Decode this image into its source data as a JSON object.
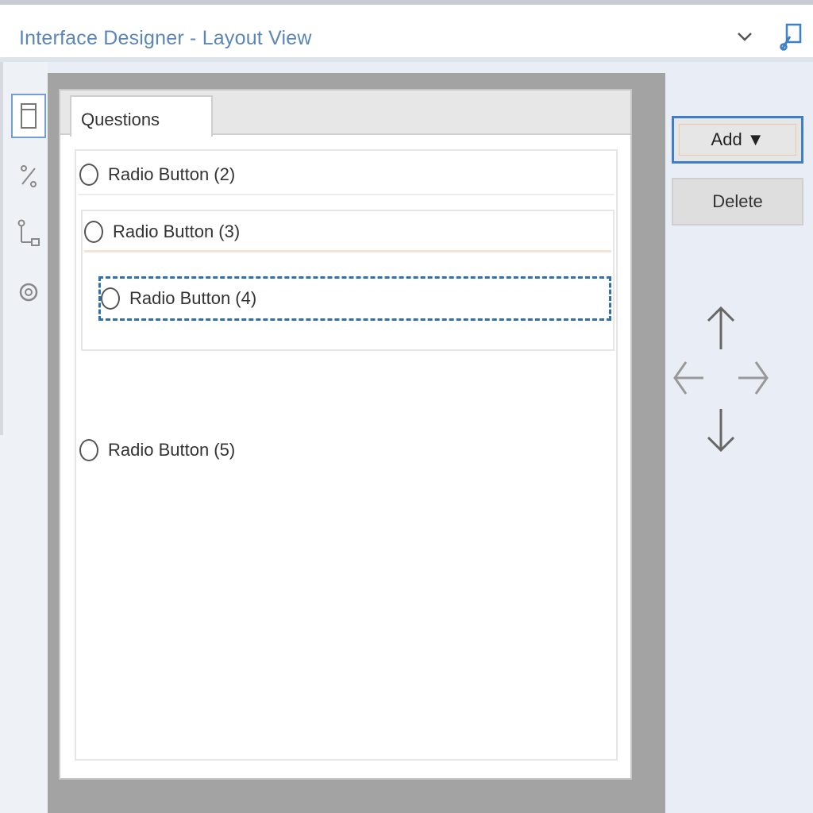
{
  "window": {
    "title": "Interface Designer - Layout View"
  },
  "toolbar": {
    "dropdown_icon": "chevron-down-icon",
    "tool_icon": "wrench-icon"
  },
  "sidebar": {
    "items": [
      {
        "icon": "layout-view-icon",
        "active": true
      },
      {
        "icon": "actions-icon",
        "active": false
      },
      {
        "icon": "tree-view-icon",
        "active": false
      },
      {
        "icon": "properties-gear-icon",
        "active": false
      }
    ]
  },
  "canvas": {
    "tab_label": "Questions",
    "radio_buttons": [
      {
        "label": "Radio Button (2)",
        "indent": 0,
        "selected": false
      },
      {
        "label": "Radio Button (3)",
        "indent": 0,
        "selected": false
      },
      {
        "label": "Radio Button (4)",
        "indent": 1,
        "selected": true
      },
      {
        "label": "Radio Button (5)",
        "indent": 0,
        "selected": false
      }
    ]
  },
  "actions": {
    "add_label": "Add",
    "add_caret": "▼",
    "delete_label": "Delete"
  },
  "move_arrows": [
    "up",
    "left",
    "right",
    "down"
  ],
  "colors": {
    "title_text": "#5b86b8",
    "selection_outline": "#2f6fae",
    "add_button_border": "#3d7fc9"
  }
}
